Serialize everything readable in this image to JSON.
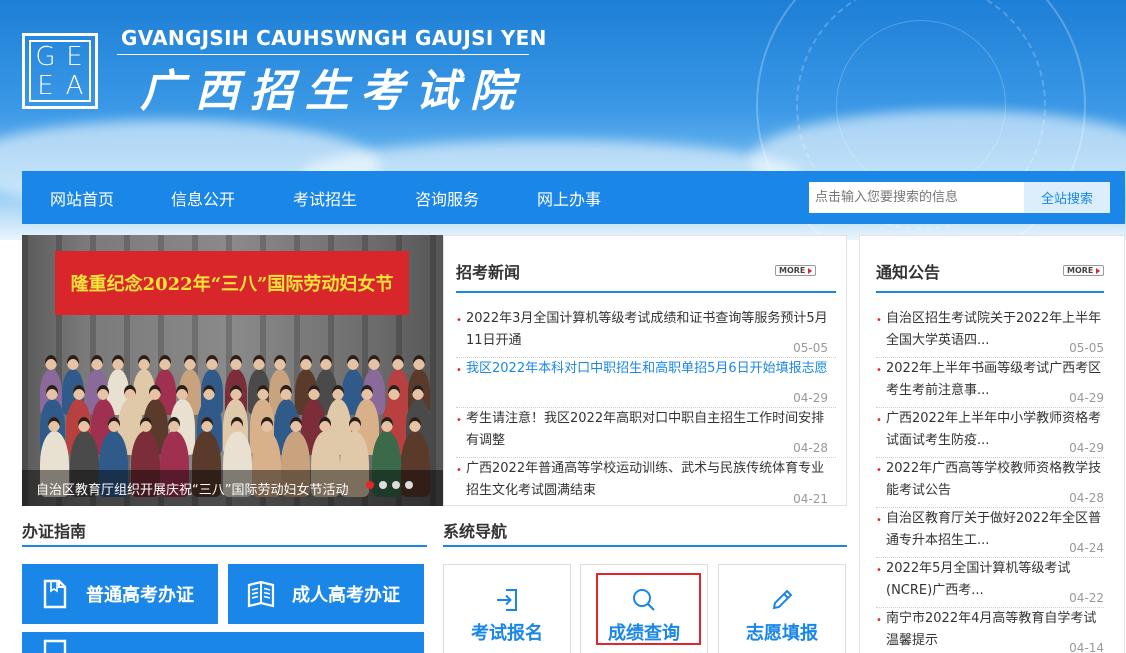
{
  "header": {
    "logo_letters": [
      "G",
      "E",
      "E",
      "A"
    ],
    "site_name_en": "GVANGJSIH CAUHSWNGH GAUJSI YEN",
    "site_name_cn": "广西招生考试院"
  },
  "nav": {
    "items": [
      "网站首页",
      "信息公开",
      "考试招生",
      "咨询服务",
      "网上办事"
    ],
    "search_placeholder": "点击输入您要搜索的信息",
    "search_button": "全站搜索"
  },
  "slideshow": {
    "banner_text": "隆重纪念2022年“三八”国际劳动妇女节",
    "caption": "自治区教育厅组织开展庆祝“三八”国际劳动妇女节活动",
    "dot_count": 4,
    "active_dot": 1
  },
  "news": {
    "title": "招考新闻",
    "more_label": "MORE",
    "items": [
      {
        "text": "2022年3月全国计算机等级考试成绩和证书查询等服务预计5月11日开通",
        "date": "05-05",
        "highlight": false
      },
      {
        "text": "我区2022年本科对口中职招生和高职单招5月6日开始填报志愿",
        "date": "04-29",
        "highlight": true
      },
      {
        "text": "考生请注意！我区2022年高职对口中职自主招生工作时间安排有调整",
        "date": "04-28",
        "highlight": false
      },
      {
        "text": "广西2022年普通高等学校运动训练、武术与民族传统体育专业招生文化考试圆满结束",
        "date": "04-21",
        "highlight": false
      }
    ]
  },
  "notice": {
    "title": "通知公告",
    "more_label": "MORE",
    "items": [
      {
        "text": "自治区招生考试院关于2022年上半年全国大学英语四...",
        "date": "05-05"
      },
      {
        "text": "2022年上半年书画等级考试广西考区考生考前注意事...",
        "date": "04-29"
      },
      {
        "text": "广西2022年上半年中小学教师资格考试面试考生防疫...",
        "date": "04-29"
      },
      {
        "text": "2022年广西高等学校教师资格教学技能考试公告",
        "date": "04-28"
      },
      {
        "text": "自治区教育厅关于做好2022年全区普通专升本招生工...",
        "date": "04-24"
      },
      {
        "text": "2022年5月全国计算机等级考试(NCRE)广西考...",
        "date": "04-22"
      },
      {
        "text": "南宁市2022年4月高等教育自学考试温馨提示",
        "date": "04-14"
      }
    ]
  },
  "guide": {
    "title": "办证指南",
    "buttons": [
      "普通高考办证",
      "成人高考办证"
    ]
  },
  "system_nav": {
    "title": "系统导航",
    "cards": [
      "考试报名",
      "成绩查询",
      "志愿填报"
    ]
  },
  "colors": {
    "primary_blue": "#1a87e8",
    "accent_red": "#e4262a"
  }
}
